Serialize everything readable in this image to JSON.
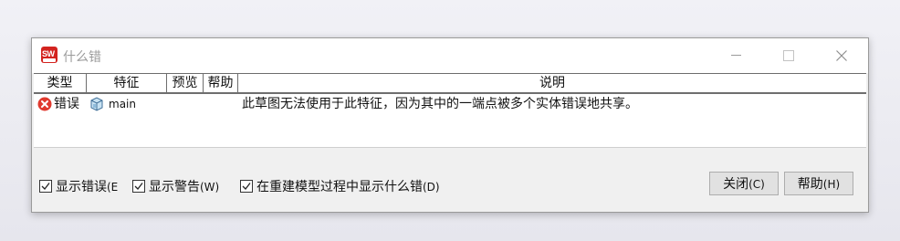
{
  "window": {
    "title": "什么错",
    "app_icon_text": "SW"
  },
  "table": {
    "columns": [
      "类型",
      "特征",
      "预览",
      "帮助",
      "说明"
    ],
    "rows": [
      {
        "type_icon": "error-icon",
        "type": "错误",
        "feature_icon": "part-icon",
        "feature": "main",
        "preview": "",
        "help": "",
        "description": "此草图无法使用于此特征，因为其中的一端点被多个实体错误地共享。"
      }
    ]
  },
  "options": {
    "show_errors": {
      "label": "显示错误",
      "hotkey": "(E",
      "checked": true
    },
    "show_warnings": {
      "label": "显示警告",
      "hotkey": "(W)",
      "checked": true
    },
    "show_during_rebuild": {
      "label": "在重建模型过程中显示什么错",
      "hotkey": "(D)",
      "checked": true
    }
  },
  "buttons": {
    "close": {
      "label": "关闭",
      "hotkey": "(C)"
    },
    "help": {
      "label": "帮助",
      "hotkey": "(H)"
    }
  },
  "colors": {
    "error_red": "#e03a2f",
    "app_red": "#d3231f"
  }
}
